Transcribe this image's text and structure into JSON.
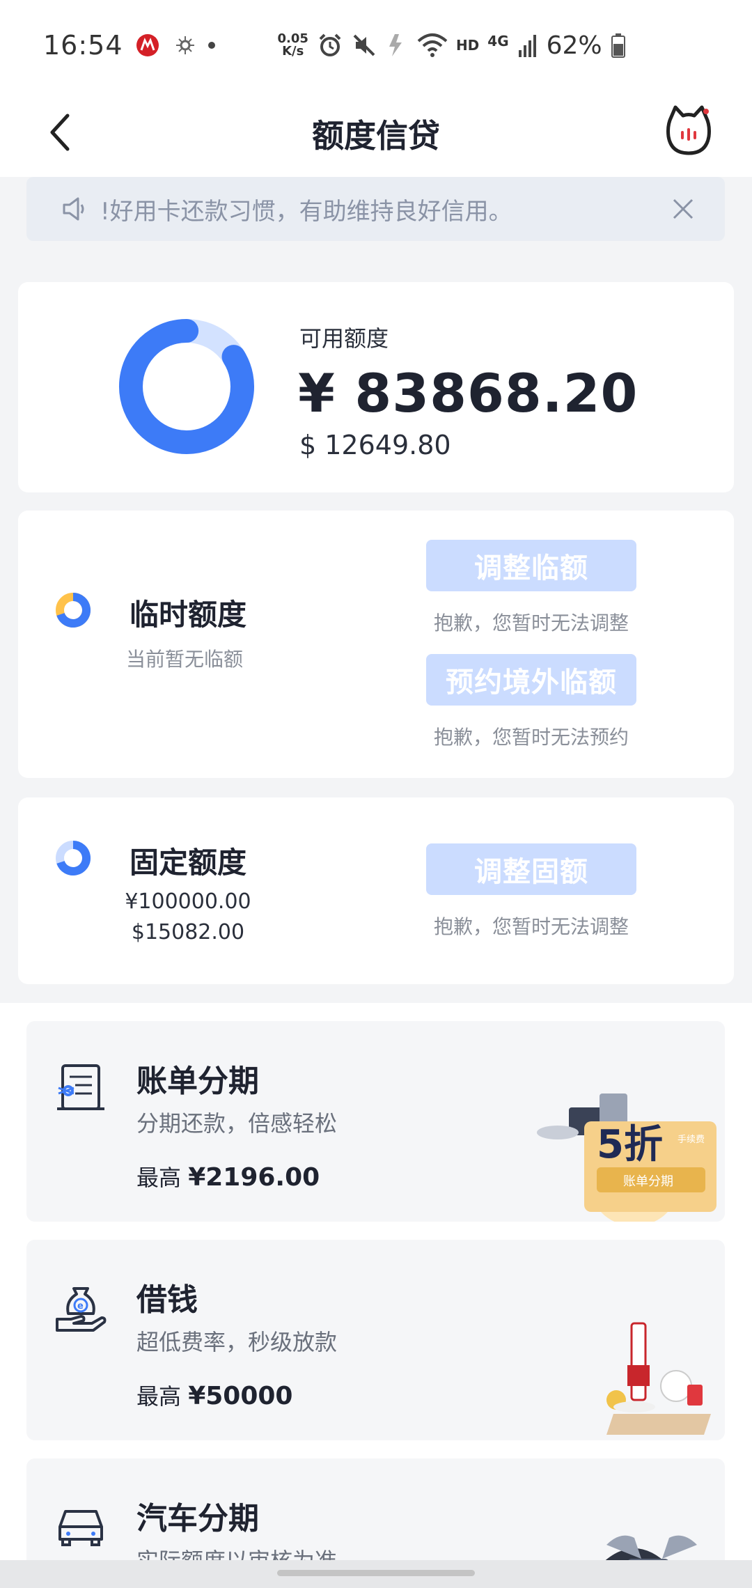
{
  "status_bar": {
    "time": "16:54",
    "speed_value": "0.05",
    "speed_unit": "K/s",
    "network_hd": "HD",
    "network_gen": "4G",
    "battery": "62%"
  },
  "header": {
    "title": "额度信贷"
  },
  "notice": {
    "text": "!好用卡还款习惯，有助维持良好信用。"
  },
  "available": {
    "label": "可用额度",
    "cny": "¥ 83868.20",
    "usd": "$ 12649.80",
    "used_fraction": 0.16
  },
  "temporary": {
    "title": "临时额度",
    "subtitle": "当前暂无临额",
    "adjust_button": "调整临额",
    "adjust_note": "抱歉，您暂时无法调整",
    "overseas_button": "预约境外临额",
    "overseas_note": "抱歉，您暂时无法预约"
  },
  "fixed": {
    "title": "固定额度",
    "cny": "¥100000.00",
    "usd": "$15082.00",
    "adjust_button": "调整固额",
    "adjust_note": "抱歉，您暂时无法调整"
  },
  "products": [
    {
      "title": "账单分期",
      "subtitle": "分期还款，倍感轻松",
      "max_label": "最高",
      "max_value": "¥2196.00",
      "badge_big": "5折",
      "badge_small": "手续费",
      "badge_label": "账单分期"
    },
    {
      "title": "借钱",
      "subtitle": "超低费率，秒级放款",
      "max_label": "最高",
      "max_value": "¥50000"
    },
    {
      "title": "汽车分期",
      "subtitle": "实际额度以审核为准"
    }
  ],
  "colors": {
    "accent": "#3d7bf7",
    "accent_light": "#cbdcff",
    "temp_yellow": "#ffc24a"
  }
}
